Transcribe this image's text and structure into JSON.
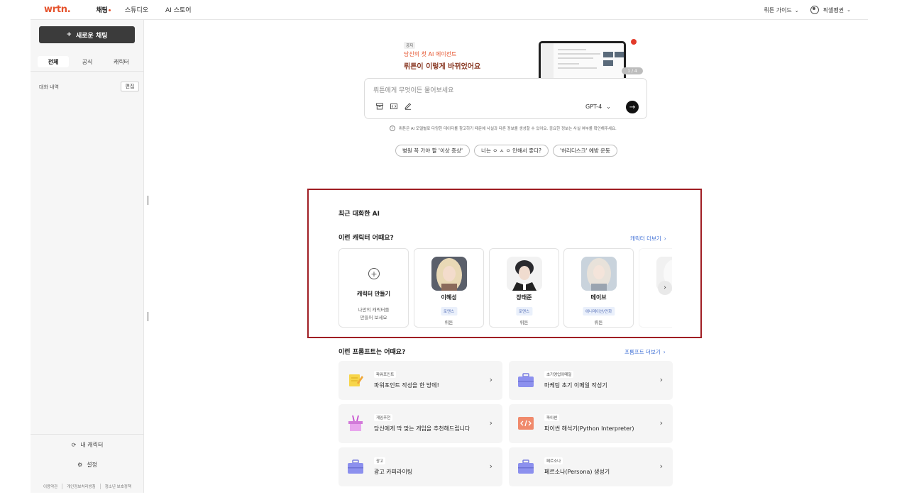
{
  "header": {
    "logo": "wrtn.",
    "nav": [
      "채팅",
      "스튜디오",
      "AI 스토어"
    ],
    "guide": "뤼튼 가이드",
    "user": "픽셀펭귄"
  },
  "sidebar": {
    "new_chat": "새로운 채팅",
    "tabs": [
      "전체",
      "공식",
      "캐릭터"
    ],
    "history_label": "대화 내역",
    "edit": "편집",
    "my_characters": "내 캐릭터",
    "settings": "설정",
    "footer_links": [
      "이용약관",
      "개인정보처리방침",
      "청소년 보호정책"
    ]
  },
  "hero": {
    "tag": "공지",
    "subtitle": "당신의 첫 AI 에이전트",
    "title": "뤼튼이 이렇게 바뀌었어요",
    "pager": "1 / 4"
  },
  "chat": {
    "placeholder": "뤼튼에게 무엇이든 물어보세요",
    "model": "GPT-4",
    "disclaimer": "뤼튼은 AI 모델별로 다양한 데이터를 참고하기 때문에 사실과 다른 정보를 생성할 수 있어요. 중요한 정보는 사실 여부를 확인해주세요.",
    "chips": [
      "병원 꼭 가야 할 '이상 증상'",
      "너는 ㅇ ㅅ ㅇ 안해서 좋다?",
      "'허리디스크' 예방 운동"
    ]
  },
  "recent": {
    "title": "최근 대화한 AI",
    "characters_title": "이런 캐릭터 어때요?",
    "more": "캐릭터 더보기",
    "create": {
      "title": "캐릭터 만들기",
      "desc1": "나만의 캐릭터를",
      "desc2": "만들어 보세요"
    },
    "cards": [
      {
        "name": "이혜성",
        "tag": "로맨스",
        "author": "뤼튼"
      },
      {
        "name": "장태준",
        "tag": "로맨스",
        "author": "뤼튼"
      },
      {
        "name": "메이브",
        "tag": "애니메이션/만화",
        "author": "뤼튼"
      }
    ]
  },
  "prompts": {
    "title": "이런 프롬프트는 어때요?",
    "more": "프롬프트 더보기",
    "items": [
      {
        "tag": "파워포인트",
        "title": "파워포인트 작성을 한 방에!"
      },
      {
        "tag": "초기영업이메일",
        "title": "마케팅 초기 이메일 작성기"
      },
      {
        "tag": "게임추천",
        "title": "당신에게 딱 맞는 게임을 추천해드립니다"
      },
      {
        "tag": "파이썬",
        "title": "파이썬 해석기(Python Interpreter)"
      },
      {
        "tag": "광고",
        "title": "광고 카피라이팅"
      },
      {
        "tag": "페르소나",
        "title": "페르소나(Persona) 생성기"
      }
    ]
  },
  "colors": {
    "accent": "#e5532d",
    "link": "#3e6fd6",
    "highlight_border": "#a01e24"
  }
}
